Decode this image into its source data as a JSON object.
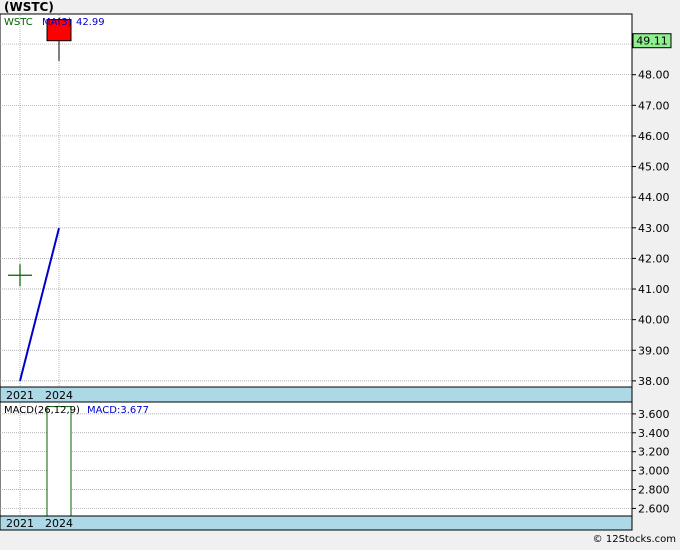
{
  "title": "(WSTC)",
  "watermark": "© 12Stocks.com",
  "colors": {
    "background": "#f0f0f0",
    "plot_bg": "#ffffff",
    "axis_band": "#add8e6",
    "grid": "#999999",
    "candle_down": "#ff0000",
    "ma_line": "#0000cc",
    "cross_marker": "#006400",
    "macd_bar_border": "#006400",
    "last_price_box": "#90ee90",
    "legend_ticker": "#006400",
    "legend_ma": "#0000cc"
  },
  "chart_data": [
    {
      "type": "candlestick",
      "legend": {
        "ticker": "WSTC",
        "ma_label": "MA(3)",
        "ma_value": "42.99"
      },
      "x_tick_labels": [
        "2021",
        "2024"
      ],
      "y_ticks": [
        "38.00",
        "39.00",
        "40.00",
        "41.00",
        "42.00",
        "43.00",
        "44.00",
        "45.00",
        "46.00",
        "47.00",
        "48.00",
        "49.00"
      ],
      "ylim": [
        37.8,
        49.95
      ],
      "last_price_label": "49.11",
      "last_price": 49.11,
      "candles": [
        {
          "period": "2024",
          "open": 49.8,
          "close": 49.11,
          "high": 49.85,
          "low": 48.45
        }
      ],
      "cross_marker": {
        "period": "2021",
        "value": 41.45
      },
      "ma_line": [
        {
          "period": "2021",
          "value": 38.0
        },
        {
          "period": "2024",
          "value": 42.99
        }
      ]
    },
    {
      "type": "bar",
      "legend": {
        "label": "MACD(26,12,9)",
        "value_label": "MACD:3.677"
      },
      "x_tick_labels": [
        "2021",
        "2024"
      ],
      "y_ticks": [
        "2.600",
        "2.800",
        "3.000",
        "3.200",
        "3.400",
        "3.600"
      ],
      "ylim": [
        2.52,
        3.715
      ],
      "bars": [
        {
          "period": "2024",
          "value": 3.677
        }
      ]
    }
  ]
}
